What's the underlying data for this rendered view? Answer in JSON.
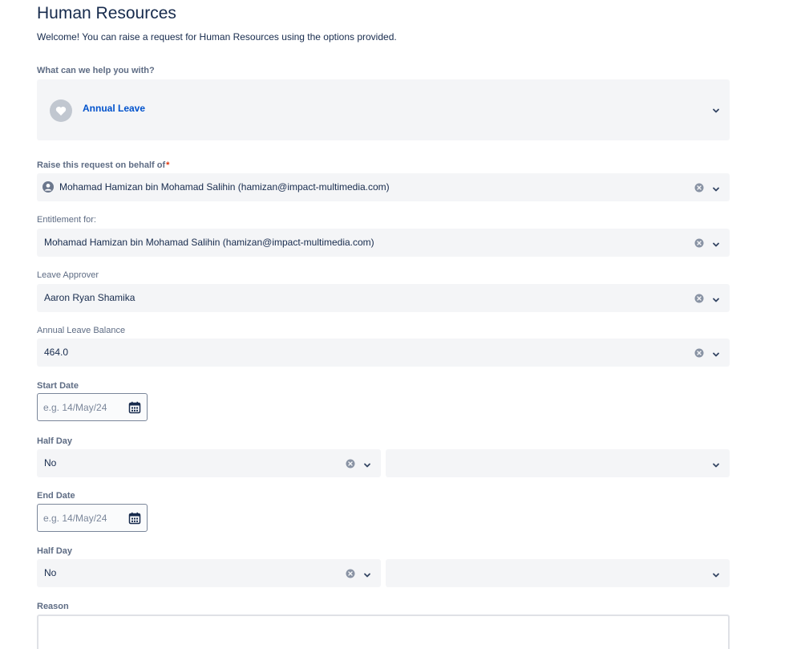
{
  "header": {
    "title": "Human Resources",
    "welcome": "Welcome! You can raise a request for Human Resources using the options provided."
  },
  "request_type": {
    "label": "What can we help you with?",
    "value": "Annual Leave",
    "icon": "heart-icon"
  },
  "on_behalf": {
    "label": "Raise this request on behalf of",
    "required_mark": "*",
    "value": "Mohamad Hamizan bin Mohamad Salihin (hamizan@impact-multimedia.com)"
  },
  "entitlement": {
    "label": "Entitlement for:",
    "value": "Mohamad Hamizan bin Mohamad Salihin (hamizan@impact-multimedia.com)"
  },
  "approver": {
    "label": "Leave Approver",
    "value": "Aaron Ryan Shamika"
  },
  "balance": {
    "label": "Annual Leave Balance",
    "value": "464.0"
  },
  "start_date": {
    "label": "Start Date",
    "placeholder": "e.g. 14/May/24"
  },
  "half_day_1": {
    "label": "Half Day",
    "value": "No",
    "second_value": ""
  },
  "end_date": {
    "label": "End Date",
    "placeholder": "e.g. 14/May/24"
  },
  "half_day_2": {
    "label": "Half Day",
    "value": "No",
    "second_value": ""
  },
  "reason": {
    "label": "Reason",
    "value": ""
  },
  "colors": {
    "field_bg": "#f4f5f7",
    "link": "#0052cc",
    "label": "#5e6c84",
    "required": "#de350b"
  }
}
